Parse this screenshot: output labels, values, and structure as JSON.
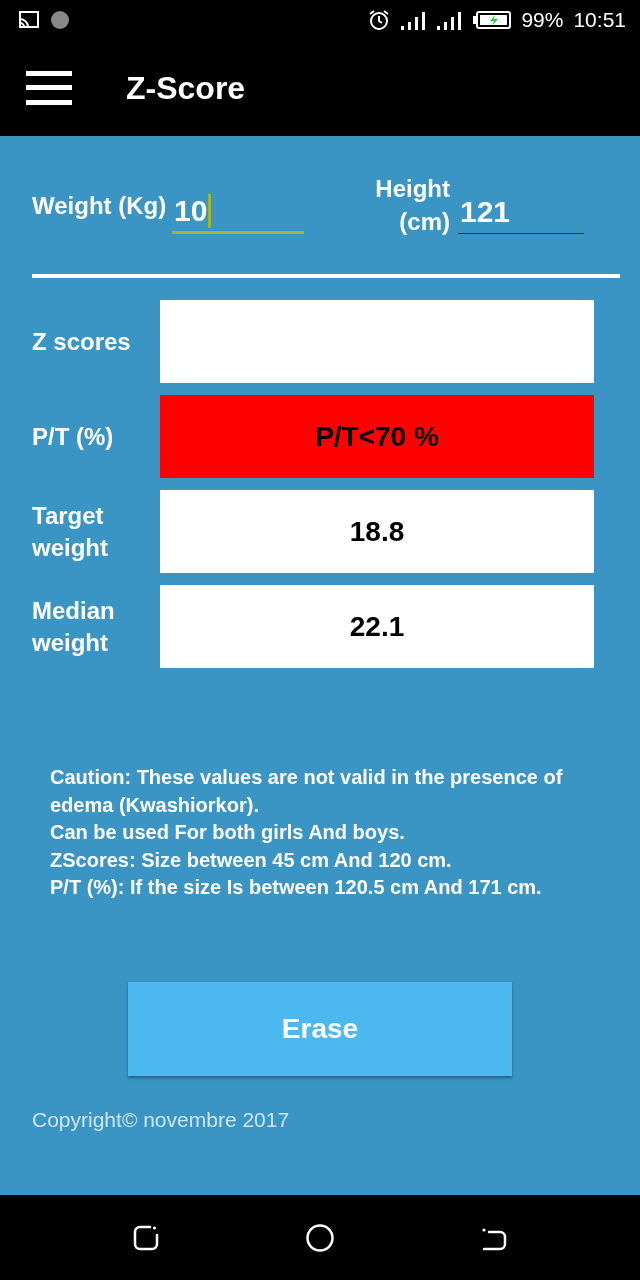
{
  "status_bar": {
    "battery": "99%",
    "time": "10:51"
  },
  "app_bar": {
    "title": "Z-Score"
  },
  "inputs": [
    {
      "label": "Weight (Kg)",
      "value": "10",
      "focused": true
    },
    {
      "label": "Height (cm)",
      "value": "121",
      "focused": false
    }
  ],
  "results": [
    {
      "label": "Z scores",
      "color": "#ffffff"
    },
    {
      "label": "P/T (%)",
      "value": "P/T<70 %",
      "color": "#ff0000"
    },
    {
      "label": "Target weight",
      "value": "18.8",
      "color": "#ffffff"
    },
    {
      "label": "Median weight",
      "value": "22.1",
      "color": "#ffffff"
    }
  ],
  "notes": [
    "Caution: These values are not valid in the presence of edema (Kwashiorkor).",
    "Can be used For both girls And boys.",
    "ZScores: Size between 45 cm And 120 cm.",
    "P/T (%): If the size Is between 120.5 cm And 171 cm."
  ],
  "button": "Erase",
  "copyright": "Copyright© novembre 2017"
}
